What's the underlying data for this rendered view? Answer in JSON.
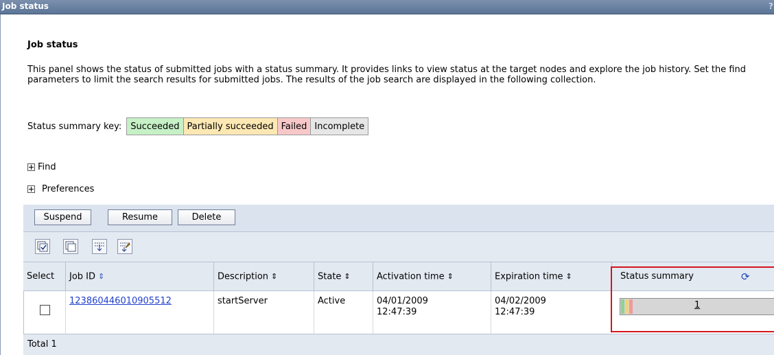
{
  "window": {
    "title": "Job status",
    "help_glyph": "?"
  },
  "panel": {
    "heading": "Job status",
    "description": "This panel shows the status of submitted jobs with a status summary. It provides links to view status at the target nodes and explore the job history. Set the find parameters to limit the search results for submitted jobs. The results of the job search are displayed in the following collection."
  },
  "status_key": {
    "label": "Status summary key:",
    "items": [
      {
        "label": "Succeeded",
        "color": "#c6f0c6"
      },
      {
        "label": "Partially succeeded",
        "color": "#fde8b4"
      },
      {
        "label": "Failed",
        "color": "#f8c8c8"
      },
      {
        "label": "Incomplete",
        "color": "#e6e6e6"
      }
    ]
  },
  "expanders": {
    "find": "Find",
    "preferences": "Preferences"
  },
  "buttons": {
    "suspend": "Suspend",
    "resume": "Resume",
    "delete": "Delete"
  },
  "icons": [
    "select-all-icon",
    "deselect-all-icon",
    "show-filter-icon",
    "clear-filter-icon"
  ],
  "table": {
    "columns": [
      "Select",
      "Job ID",
      "Description",
      "State",
      "Activation time",
      "Expiration time",
      "Status summary"
    ],
    "rows": [
      {
        "job_id": "123860446010905512",
        "description": "startServer",
        "state": "Active",
        "activation_time": "04/01/2009 12:47:39",
        "expiration_time": "04/02/2009 12:47:39",
        "status_count": "1",
        "status_colors": [
          "#8fd28f",
          "#f2d27a",
          "#ef9a9a"
        ]
      }
    ],
    "total": "Total 1"
  }
}
